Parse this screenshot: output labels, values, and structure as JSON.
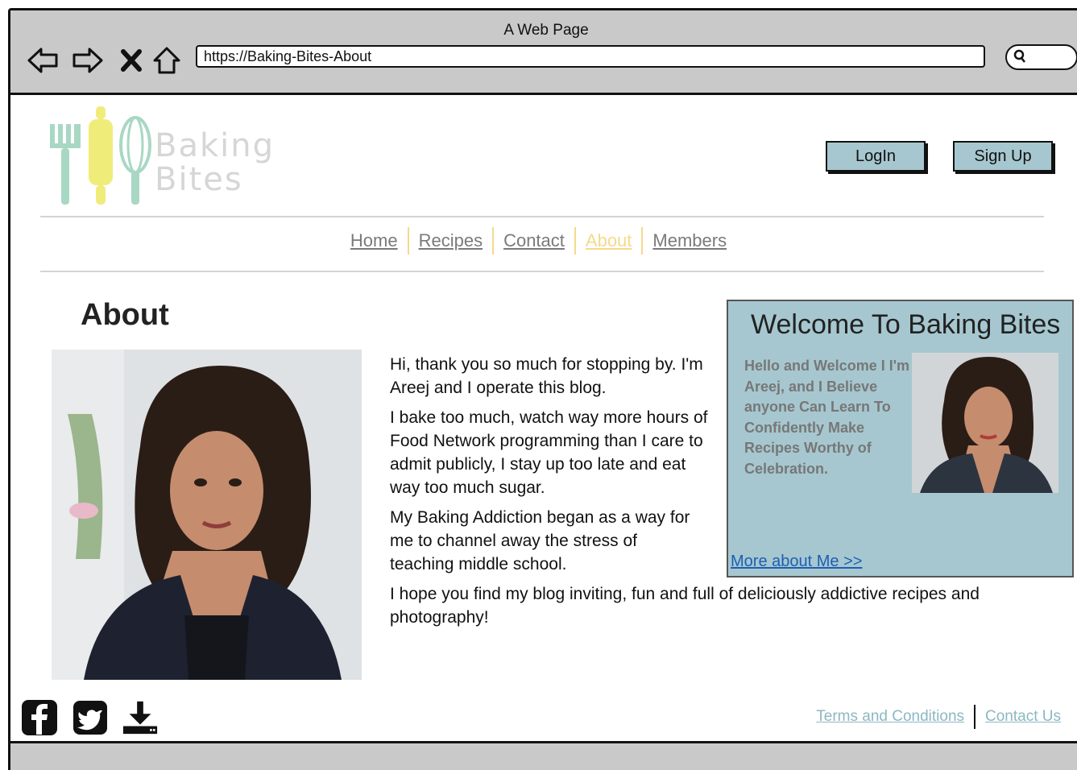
{
  "window": {
    "title": "A Web Page"
  },
  "browser": {
    "url": "https://Baking-Bites-About",
    "icons": [
      "back-arrow-icon",
      "forward-arrow-icon",
      "close-x-icon",
      "home-icon",
      "search-icon"
    ]
  },
  "brand": {
    "line1": "Baking",
    "line2": "Bites"
  },
  "auth": {
    "login": "LogIn",
    "signup": "Sign Up"
  },
  "nav": {
    "items": [
      {
        "label": "Home"
      },
      {
        "label": "Recipes"
      },
      {
        "label": "Contact"
      },
      {
        "label": "About",
        "active": true
      },
      {
        "label": "Members"
      }
    ]
  },
  "page": {
    "heading": "About"
  },
  "bio": {
    "p1": "Hi, thank you so much for stopping by. I'm Areej and I operate this blog.",
    "p2": "I bake too much, watch way more hours of Food Network programming than I care to admit publicly, I stay up too late and eat way too much sugar.",
    "p3": "My Baking Addiction began as a way for me to channel away the stress of teaching middle school.",
    "p4": "I hope you find my blog inviting, fun and full of deliciously addictive recipes and photography!"
  },
  "welcome": {
    "title": "Welcome To Baking Bites",
    "text": "Hello and Welcome I I'm Areej, and I Believe anyone Can Learn To Confidently Make Recipes Worthy of Celebration.",
    "link": "More about Me >>"
  },
  "social": {
    "icons": [
      "facebook-icon",
      "twitter-icon",
      "download-icon"
    ]
  },
  "footer": {
    "terms": "Terms and Conditions",
    "contact": "Contact Us"
  },
  "colors": {
    "chrome": "#c9c9c9",
    "accent": "#a6c7cf",
    "navActive": "#f5d98c",
    "link": "#1d5fb5",
    "footerLink": "#8cb8c3"
  }
}
